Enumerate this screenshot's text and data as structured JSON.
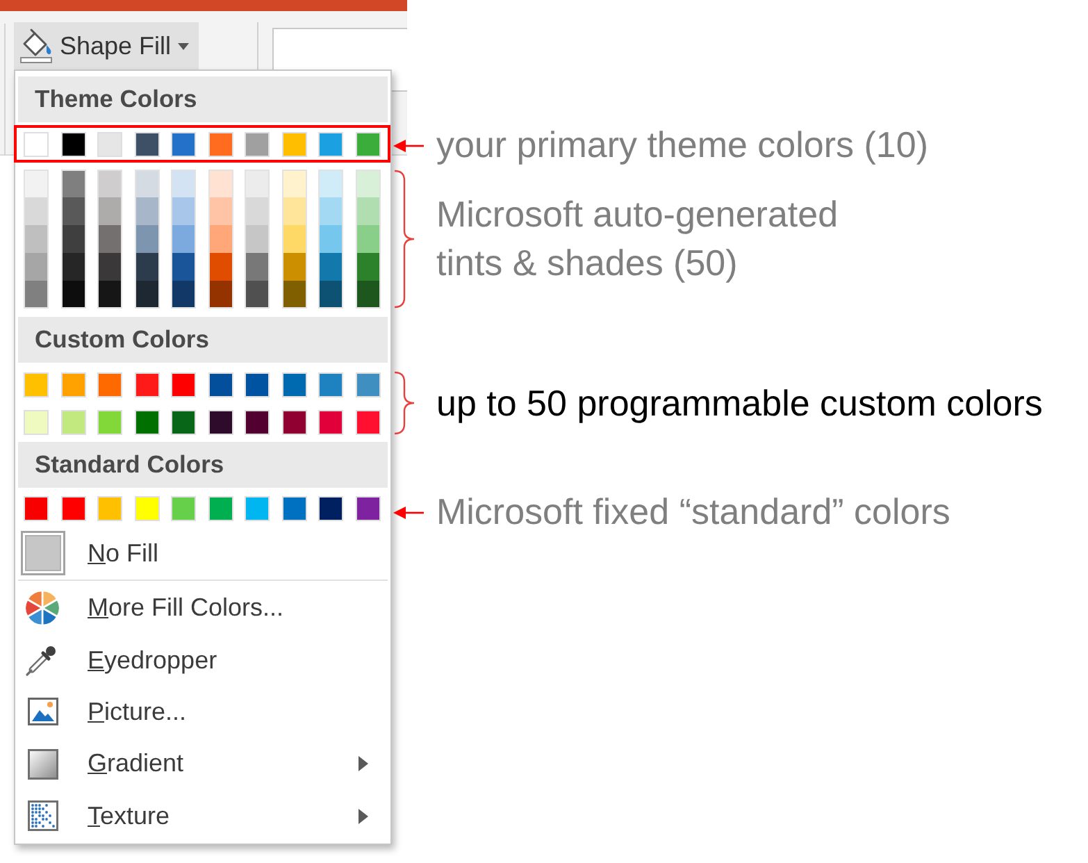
{
  "ribbon": {
    "shape_fill_button": {
      "label": "Shape Fill"
    }
  },
  "menu": {
    "theme_colors": {
      "title": "Theme Colors",
      "swatches": [
        {
          "color": "#ffffff"
        },
        {
          "color": "#000000"
        },
        {
          "color": "#e7e6e6"
        },
        {
          "color": "#3d5066"
        },
        {
          "color": "#2371c8"
        },
        {
          "color": "#ff6c1f"
        },
        {
          "color": "#a0a0a0"
        },
        {
          "color": "#ffbf00"
        },
        {
          "color": "#1ba1e2"
        },
        {
          "color": "#3aad3a"
        }
      ],
      "shade_columns": [
        {
          "shades": [
            {
              "color": "#f2f2f2"
            },
            {
              "color": "#d9d9d9"
            },
            {
              "color": "#bfbfbf"
            },
            {
              "color": "#a6a6a6"
            },
            {
              "color": "#808080"
            }
          ]
        },
        {
          "shades": [
            {
              "color": "#7f7f7f"
            },
            {
              "color": "#595959"
            },
            {
              "color": "#3f3f3f"
            },
            {
              "color": "#262626"
            },
            {
              "color": "#0d0d0d"
            }
          ]
        },
        {
          "shades": [
            {
              "color": "#cfcdcd"
            },
            {
              "color": "#aeabab"
            },
            {
              "color": "#757070"
            },
            {
              "color": "#3a3838"
            },
            {
              "color": "#171616"
            }
          ]
        },
        {
          "shades": [
            {
              "color": "#d4dbe3"
            },
            {
              "color": "#a8b6c9"
            },
            {
              "color": "#7e95b0"
            },
            {
              "color": "#2d3c4d"
            },
            {
              "color": "#1e2833"
            }
          ]
        },
        {
          "shades": [
            {
              "color": "#d3e3f4"
            },
            {
              "color": "#a7c6e9"
            },
            {
              "color": "#7caade"
            },
            {
              "color": "#1a559a"
            },
            {
              "color": "#113866"
            }
          ]
        },
        {
          "shades": [
            {
              "color": "#ffe2d2"
            },
            {
              "color": "#ffc4a5"
            },
            {
              "color": "#ffa779"
            },
            {
              "color": "#e04c00"
            },
            {
              "color": "#953300"
            }
          ]
        },
        {
          "shades": [
            {
              "color": "#ececec"
            },
            {
              "color": "#d9d9d9"
            },
            {
              "color": "#c6c6c6"
            },
            {
              "color": "#787878"
            },
            {
              "color": "#505050"
            }
          ]
        },
        {
          "shades": [
            {
              "color": "#fff2cc"
            },
            {
              "color": "#ffe599"
            },
            {
              "color": "#ffd966"
            },
            {
              "color": "#cc8f00"
            },
            {
              "color": "#805f00"
            }
          ]
        },
        {
          "shades": [
            {
              "color": "#d1ecf9"
            },
            {
              "color": "#a4d9f3"
            },
            {
              "color": "#76c7ee"
            },
            {
              "color": "#1379ad"
            },
            {
              "color": "#0d5173"
            }
          ]
        },
        {
          "shades": [
            {
              "color": "#d8efd8"
            },
            {
              "color": "#b0deb0"
            },
            {
              "color": "#89ce89"
            },
            {
              "color": "#2b822b"
            },
            {
              "color": "#1d571d"
            }
          ]
        }
      ]
    },
    "custom_colors": {
      "title": "Custom Colors",
      "rows": [
        {
          "swatches": [
            {
              "color": "#ffc000"
            },
            {
              "color": "#ffa200"
            },
            {
              "color": "#ff6a00"
            },
            {
              "color": "#ff1a1a"
            },
            {
              "color": "#ff0000"
            },
            {
              "color": "#034f9c"
            },
            {
              "color": "#0053a0"
            },
            {
              "color": "#006ab0"
            },
            {
              "color": "#1f82c0"
            },
            {
              "color": "#3f90c0"
            }
          ]
        },
        {
          "swatches": [
            {
              "color": "#eefabf"
            },
            {
              "color": "#c1e97f"
            },
            {
              "color": "#82d839"
            },
            {
              "color": "#007100"
            },
            {
              "color": "#086619"
            },
            {
              "color": "#2e0b2a"
            },
            {
              "color": "#510030"
            },
            {
              "color": "#900030"
            },
            {
              "color": "#e1003a"
            },
            {
              "color": "#ff1030"
            }
          ]
        }
      ]
    },
    "standard_colors": {
      "title": "Standard Colors",
      "swatches": [
        {
          "color": "#f80000"
        },
        {
          "color": "#ff0000"
        },
        {
          "color": "#ffc000"
        },
        {
          "color": "#ffff00"
        },
        {
          "color": "#66d04a"
        },
        {
          "color": "#00b050"
        },
        {
          "color": "#00b6f0"
        },
        {
          "color": "#0070c0"
        },
        {
          "color": "#002060"
        },
        {
          "color": "#7f22a0"
        }
      ]
    },
    "no_fill": {
      "label": "No Fill",
      "mnemonic": true
    },
    "items": [
      {
        "kind": "wheel",
        "label": "More Fill Colors...",
        "mnemonic": true,
        "submenu": false
      },
      {
        "kind": "eyedropper",
        "label": "Eyedropper",
        "mnemonic": true,
        "submenu": false
      },
      {
        "kind": "picture",
        "label": "Picture...",
        "mnemonic": true,
        "submenu": false
      },
      {
        "kind": "gradient",
        "label": "Gradient",
        "mnemonic": true,
        "submenu": true
      },
      {
        "kind": "texture",
        "label": "Texture",
        "mnemonic": true,
        "submenu": true
      }
    ]
  },
  "annotations": [
    {
      "kind": "boxed_arrow",
      "text": "your primary theme colors (10)",
      "color": "#7f7f7f"
    },
    {
      "kind": "brace",
      "text": "Microsoft auto-generated tints & shades (50)",
      "color": "#7f7f7f"
    },
    {
      "kind": "brace",
      "text": "up to 50 programmable custom colors",
      "color": "#000000"
    },
    {
      "kind": "arrow",
      "text": "Microsoft fixed “standard” colors",
      "color": "#7f7f7f"
    }
  ]
}
